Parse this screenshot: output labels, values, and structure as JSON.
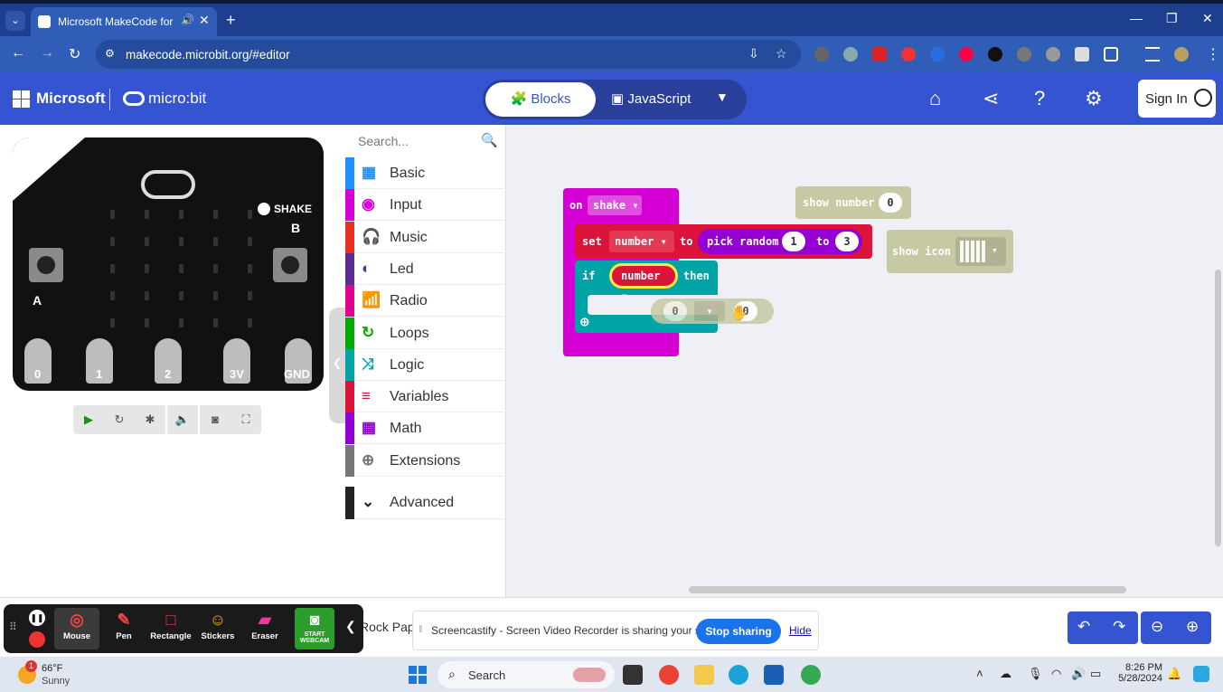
{
  "browser": {
    "tab_title": "Microsoft MakeCode for micro:bit",
    "tab_close": "✕",
    "new_tab": "+",
    "url": "makecode.microbit.org/#editor",
    "controls": {
      "minimize": "—",
      "restore": "❐",
      "close": "✕"
    }
  },
  "header": {
    "brand": "Microsoft",
    "product": "micro:bit",
    "blocks_label": "Blocks",
    "javascript_label": "JavaScript",
    "sign_in": "Sign In"
  },
  "simulator": {
    "pins": [
      "0",
      "1",
      "2",
      "3V",
      "GND"
    ],
    "shake_label": "SHAKE",
    "button_b": "B",
    "button_a": "A"
  },
  "toolbox": {
    "search_placeholder": "Search...",
    "categories": [
      {
        "label": "Basic",
        "color": "#1e90ff",
        "icon": "▦"
      },
      {
        "label": "Input",
        "color": "#d400d4",
        "icon": "◉"
      },
      {
        "label": "Music",
        "color": "#e63022",
        "icon": "🎧"
      },
      {
        "label": "Led",
        "color": "#5c2d91",
        "icon": "◐"
      },
      {
        "label": "Radio",
        "color": "#e3008c",
        "icon": "📶"
      },
      {
        "label": "Loops",
        "color": "#00aa00",
        "icon": "↻"
      },
      {
        "label": "Logic",
        "color": "#00a4a6",
        "icon": "⤨"
      },
      {
        "label": "Variables",
        "color": "#dc143c",
        "icon": "≡"
      },
      {
        "label": "Math",
        "color": "#9400d3",
        "icon": "▦"
      },
      {
        "label": "Extensions",
        "color": "#777777",
        "icon": "⊕"
      }
    ],
    "advanced": "Advanced"
  },
  "workspace": {
    "on_shake": {
      "on": "on",
      "event": "shake"
    },
    "set_block": {
      "set": "set",
      "var": "number",
      "to": "to",
      "fn": "pick random",
      "min": "1",
      "to2": "to",
      "max": "3"
    },
    "if_block": {
      "if": "if",
      "var": "number",
      "then": "then"
    },
    "compare_block": {
      "left": "0",
      "right": "0"
    },
    "show_number": {
      "label": "show number",
      "value": "0"
    },
    "show_icon": {
      "label": "show icon"
    }
  },
  "bottom": {
    "project_name": "Rock Pap",
    "screencastify_tools": [
      "Mouse",
      "Pen",
      "Rectangle",
      "Stickers",
      "Eraser",
      "START WEBCAM"
    ],
    "share_message": "Screencastify - Screen Video Recorder is sharing your screen.",
    "stop_sharing": "Stop sharing",
    "hide": "Hide"
  },
  "taskbar": {
    "weather_temp": "66°F",
    "weather_desc": "Sunny",
    "weather_badge": "1",
    "search": "Search",
    "time": "8:26 PM",
    "date": "5/28/2024"
  }
}
